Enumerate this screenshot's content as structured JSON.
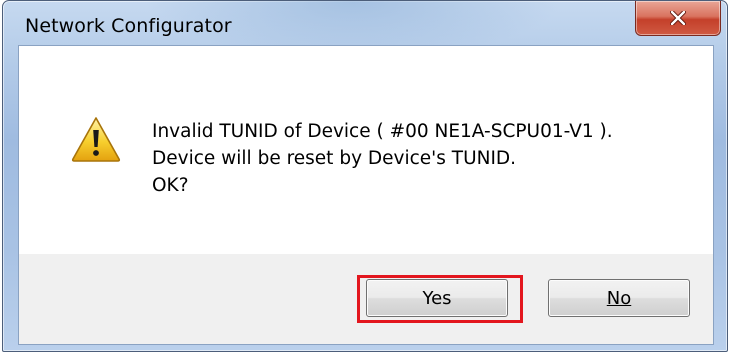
{
  "dialog": {
    "title": "Network Configurator",
    "close_icon": "close-icon",
    "warning_icon": "warning-icon",
    "message_lines": [
      "Invalid TUNID of Device ( #00 NE1A-SCPU01-V1 ).",
      "Device will be reset by Device's TUNID.",
      "OK?"
    ],
    "buttons": {
      "yes_label": "Yes",
      "no_label": "No"
    }
  },
  "colors": {
    "highlight": "#e3161e",
    "close_button": "#c4402a",
    "title_bar": "#b3cbe8"
  }
}
